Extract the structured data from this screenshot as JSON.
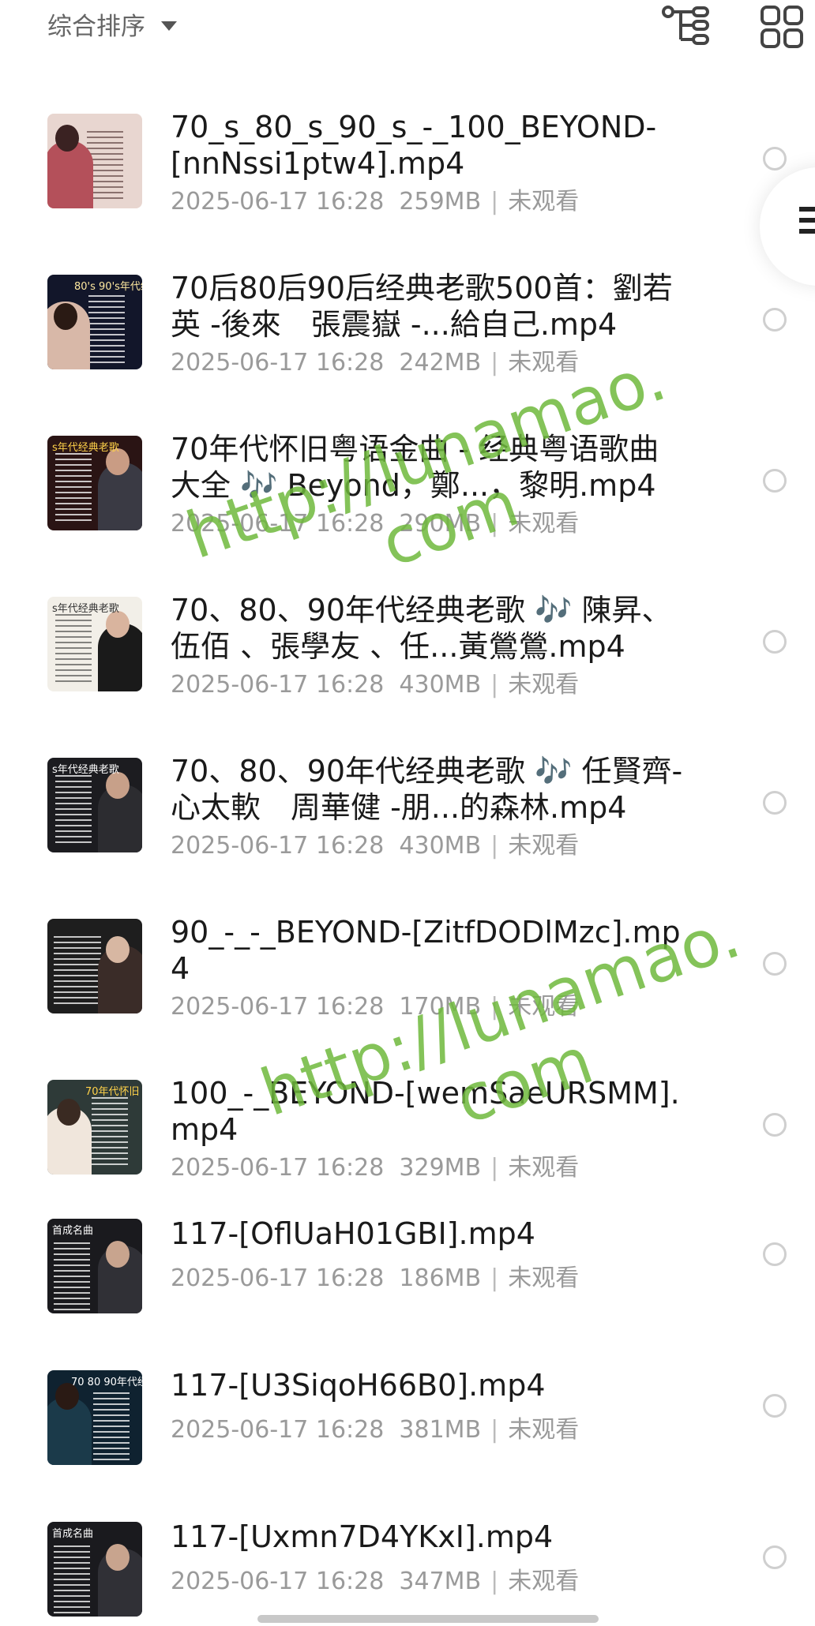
{
  "toolbar": {
    "sort_label": "综合排序",
    "tree_icon": "tree-view-icon",
    "grid_icon": "grid-view-icon"
  },
  "files": [
    {
      "name": "70_s_80_s_90_s_-_100_BEYOND-[nnNssi1ptw4].mp4",
      "date": "2025-06-17 16:28",
      "size": "259MB",
      "status": "未观看",
      "thumb_label": ""
    },
    {
      "name": "70后80后90后经典老歌500首：劉若英 -後來　張震嶽 -...給自己.mp4",
      "date": "2025-06-17 16:28",
      "size": "242MB",
      "status": "未观看",
      "thumb_label": "80's 90's年代经"
    },
    {
      "name": "70年代怀旧粤语金曲 - 经典粤语歌曲大全 🎶 Beyond，鄭...，黎明.mp4",
      "date": "2025-06-17 16:28",
      "size": "290MB",
      "status": "未观看",
      "thumb_label": "s年代经典老歌"
    },
    {
      "name": "70、80、90年代经典老歌 🎶 陳昇、伍佰 、張學友 、任...黃鶯鶯.mp4",
      "date": "2025-06-17 16:28",
      "size": "430MB",
      "status": "未观看",
      "thumb_label": "s年代经典老歌"
    },
    {
      "name": "70、80、90年代经典老歌 🎶 任賢齊-心太軟　周華健 -朋...的森林.mp4",
      "date": "2025-06-17 16:28",
      "size": "430MB",
      "status": "未观看",
      "thumb_label": "s年代经典老歌"
    },
    {
      "name": "90_-_-_BEYOND-[ZitfDODlMzc].mp4",
      "date": "2025-06-17 16:28",
      "size": "170MB",
      "status": "未观看",
      "thumb_label": ""
    },
    {
      "name": "100_-_BEYOND-[wemSaeURSMM].mp4",
      "date": "2025-06-17 16:28",
      "size": "329MB",
      "status": "未观看",
      "thumb_label": "70年代怀旧"
    },
    {
      "name": "117-[OflUaH01GBI].mp4",
      "date": "2025-06-17 16:28",
      "size": "186MB",
      "status": "未观看",
      "thumb_label": "首成名曲"
    },
    {
      "name": "117-[U3SiqoH66B0].mp4",
      "date": "2025-06-17 16:28",
      "size": "381MB",
      "status": "未观看",
      "thumb_label": "70 80 90年代经"
    },
    {
      "name": "117-[Uxmn7D4YKxI].mp4",
      "date": "2025-06-17 16:28",
      "size": "347MB",
      "status": "未观看",
      "thumb_label": "首成名曲"
    }
  ],
  "watermarks": [
    {
      "line1": "http://lunamao.",
      "line2": "com"
    },
    {
      "line1": "http://lunamao.",
      "line2": "com"
    }
  ],
  "colors": {
    "title": "#1a1a1a",
    "meta": "#9a9a9a",
    "watermark": "#6eb93c",
    "radio_border": "#cfcfcf"
  }
}
